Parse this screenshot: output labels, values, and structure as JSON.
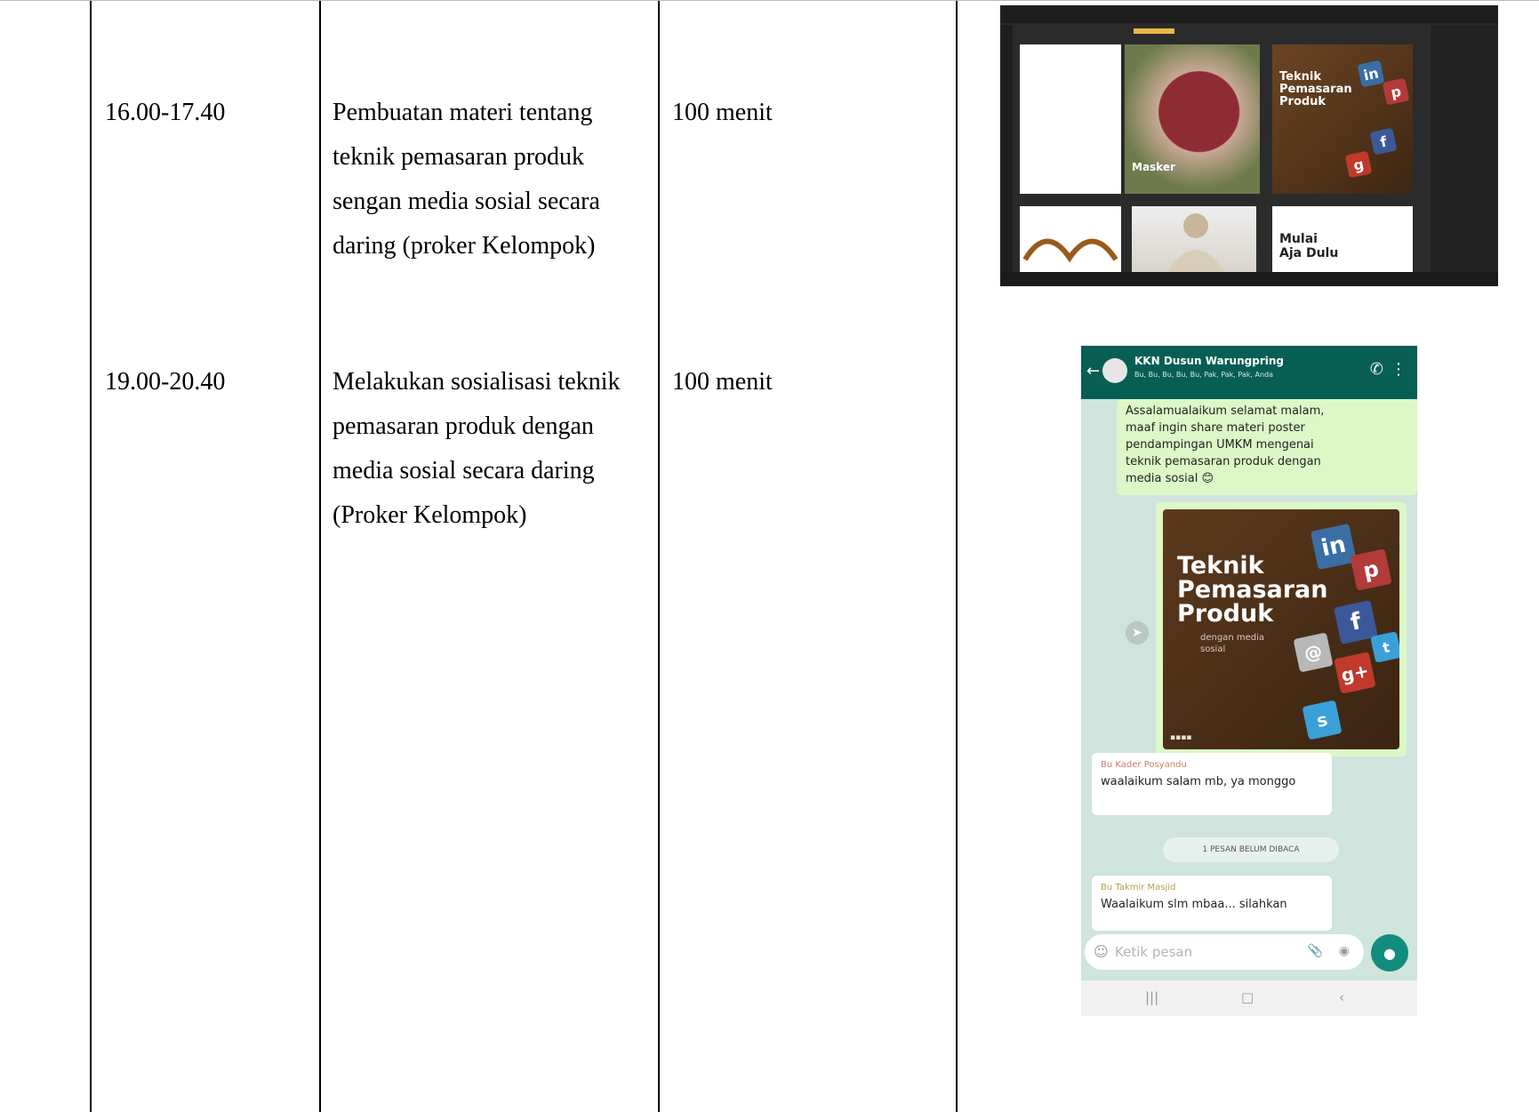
{
  "rows": [
    {
      "time": "16.00-17.40",
      "activity_lines": [
        "Pembuatan materi tentang",
        "teknik pemasaran produk",
        "sengan media sosial secara",
        "daring (proker Kelompok)"
      ],
      "duration": "100 menit"
    },
    {
      "time": "19.00-20.40",
      "activity_lines": [
        "Melakukan sosialisasi teknik",
        "pemasaran produk dengan",
        "media sosial secara daring",
        "(Proker Kelompok)"
      ],
      "duration": "100 menit"
    }
  ],
  "design_screenshot": {
    "artboard_mask_label": "Masker",
    "artboard_teknik_lines": [
      "Teknik",
      "Pemasaran",
      "Produk"
    ],
    "artboard_mulai_lines": [
      "Mulai",
      "Aja Dulu"
    ]
  },
  "chat_screenshot": {
    "header_title": "KKN Dusun Warungpring",
    "header_subtitle": "Bu, Bu, Bu, Bu, Bu, Pak, Pak, Pak, Anda",
    "back_icon": "arrow-left",
    "call_icon": "phone-plus",
    "menu_icon": "vertical-dots",
    "outgoing_message_lines": [
      "Assalamualaikum selamat malam,",
      "maaf ingin share materi poster",
      "pendampingan UMKM mengenai",
      "teknik pemasaran produk dengan",
      "media sosial 😊"
    ],
    "poster_title_lines": [
      "Teknik",
      "Pemasaran",
      "Produk"
    ],
    "poster_subtitle_lines": [
      "dengan media",
      "sosial"
    ],
    "reply1_sender": "Bu Kader Posyandu",
    "reply1_text": "waalaikum salam mb, ya monggo",
    "unread_label": "1 PESAN BELUM DIBACA",
    "reply2_sender": "Bu Takmir Masjid",
    "reply2_text": "Waalaikum slm mbaa... silahkan",
    "input_placeholder": "Ketik pesan"
  },
  "colors": {
    "chat_header": "#075e54",
    "chat_background": "#cfe4dc",
    "outgoing_bubble": "#dcf8c6",
    "mic_button": "#128c7e",
    "design_app_background": "#2b2b2b"
  }
}
